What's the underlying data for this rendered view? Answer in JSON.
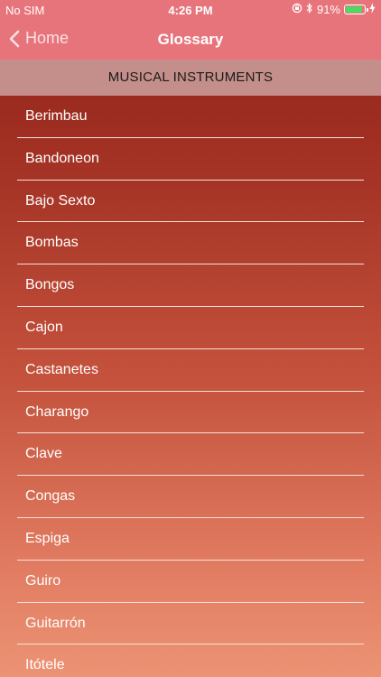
{
  "status_bar": {
    "carrier": "No SIM",
    "time": "4:26 PM",
    "battery_percent": "91%",
    "battery_level": 0.91,
    "icons": [
      "orientation-lock-icon",
      "bluetooth-icon",
      "battery-icon",
      "charging-icon"
    ]
  },
  "nav": {
    "back_label": "Home",
    "title": "Glossary"
  },
  "section": {
    "header": "MUSICAL INSTRUMENTS"
  },
  "items": [
    {
      "label": "Berimbau"
    },
    {
      "label": "Bandoneon"
    },
    {
      "label": "Bajo Sexto"
    },
    {
      "label": "Bombas"
    },
    {
      "label": "Bongos"
    },
    {
      "label": "Cajon"
    },
    {
      "label": "Castanetes"
    },
    {
      "label": "Charango"
    },
    {
      "label": "Clave"
    },
    {
      "label": "Congas"
    },
    {
      "label": "Espiga"
    },
    {
      "label": "Guiro"
    },
    {
      "label": "Guitarrón"
    },
    {
      "label": "Itótele"
    }
  ],
  "colors": {
    "nav_background": "#e8747b",
    "section_header_background": "#c48f8a",
    "list_gradient_top": "#9b2a1f",
    "list_gradient_bottom": "#ec9374",
    "battery_fill": "#4cd964"
  }
}
